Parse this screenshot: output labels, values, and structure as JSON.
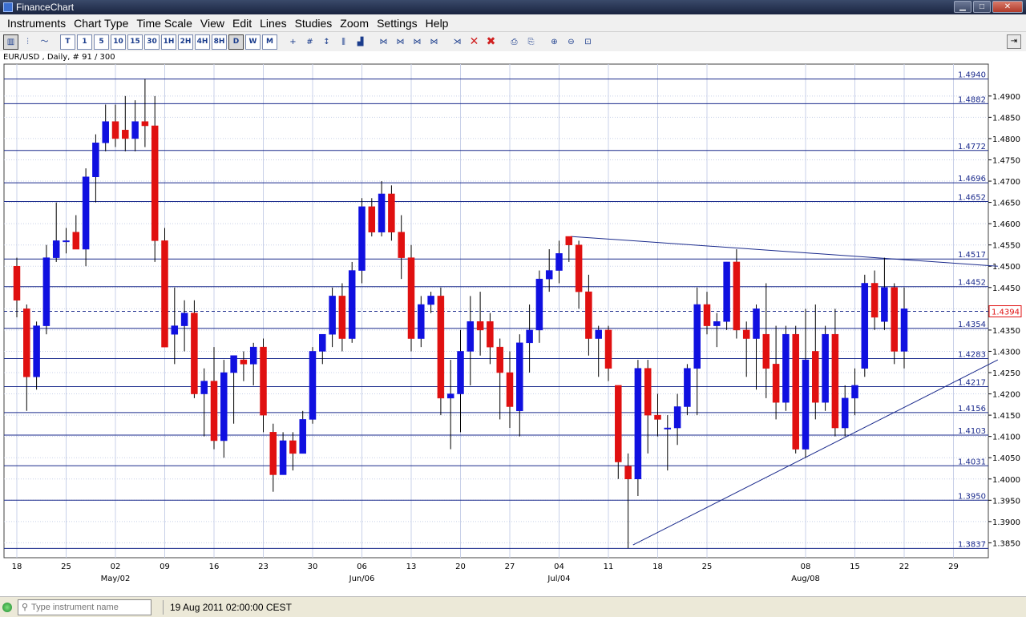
{
  "window": {
    "title": "FinanceChart",
    "min_label": "▁",
    "max_label": "□",
    "close_label": "✕"
  },
  "menu": [
    "Instruments",
    "Chart Type",
    "Time Scale",
    "View",
    "Edit",
    "Lines",
    "Studies",
    "Zoom",
    "Settings",
    "Help"
  ],
  "toolbar": {
    "timeframes": [
      "T",
      "1",
      "5",
      "10",
      "15",
      "30",
      "1H",
      "2H",
      "4H",
      "8H",
      "D",
      "W",
      "M"
    ],
    "active_timeframe": "D"
  },
  "chart_header": "EUR/USD , Daily, # 91 / 300",
  "status": {
    "search_placeholder": "Type instrument name",
    "datetime": "19 Aug 2011 02:00:00 CEST"
  },
  "chart_data": {
    "type": "candlestick",
    "instrument": "EUR/USD",
    "timeframe": "Daily",
    "ylim": [
      1.3815,
      1.4975
    ],
    "y_ticks": [
      1.385,
      1.39,
      1.395,
      1.4,
      1.405,
      1.41,
      1.415,
      1.42,
      1.425,
      1.43,
      1.435,
      1.44,
      1.445,
      1.45,
      1.455,
      1.46,
      1.465,
      1.47,
      1.475,
      1.48,
      1.485,
      1.49
    ],
    "day_ticks": [
      "18",
      "25",
      "02",
      "09",
      "16",
      "23",
      "30",
      "06",
      "13",
      "20",
      "27",
      "04",
      "11",
      "18",
      "25",
      "08",
      "15",
      "22",
      "29"
    ],
    "day_tick_positions": [
      0,
      5,
      10,
      15,
      20,
      25,
      30,
      35,
      40,
      45,
      50,
      55,
      60,
      65,
      70,
      80,
      85,
      90,
      95
    ],
    "month_labels": [
      {
        "label": "May/02",
        "pos": 10
      },
      {
        "label": "Jun/06",
        "pos": 35
      },
      {
        "label": "Jul/04",
        "pos": 55
      },
      {
        "label": "Aug/08",
        "pos": 80
      }
    ],
    "horizontal_lines": [
      1.494,
      1.4882,
      1.4772,
      1.4696,
      1.4652,
      1.4517,
      1.4452,
      1.4354,
      1.4283,
      1.4217,
      1.4156,
      1.4103,
      1.4031,
      1.395,
      1.3837
    ],
    "horizontal_line_labels": [
      "1.4940",
      "1.4882",
      "1.4772",
      "1.4696",
      "1.4652",
      "1.4517",
      "1.4452",
      "1.4354",
      "1.4283",
      "1.4217",
      "1.4156",
      "1.4103",
      "1.4031",
      "1.3950",
      "1.3837"
    ],
    "current_price": 1.4394,
    "current_price_label": "1.4394",
    "trend_lines": [
      {
        "from": {
          "bar": 56.2,
          "price": 1.457
        },
        "to": {
          "bar": 99.5,
          "price": 1.45
        }
      },
      {
        "from": {
          "bar": 62.5,
          "price": 1.3845
        },
        "to": {
          "bar": 99.5,
          "price": 1.428
        }
      }
    ],
    "candles": [
      {
        "i": 0,
        "o": 1.45,
        "h": 1.452,
        "l": 1.438,
        "c": 1.442
      },
      {
        "i": 1,
        "o": 1.44,
        "h": 1.441,
        "l": 1.416,
        "c": 1.424
      },
      {
        "i": 2,
        "o": 1.424,
        "h": 1.437,
        "l": 1.421,
        "c": 1.436
      },
      {
        "i": 3,
        "o": 1.436,
        "h": 1.455,
        "l": 1.434,
        "c": 1.452
      },
      {
        "i": 4,
        "o": 1.452,
        "h": 1.465,
        "l": 1.451,
        "c": 1.456
      },
      {
        "i": 5,
        "o": 1.456,
        "h": 1.459,
        "l": 1.453,
        "c": 1.456
      },
      {
        "i": 6,
        "o": 1.458,
        "h": 1.462,
        "l": 1.454,
        "c": 1.454
      },
      {
        "i": 7,
        "o": 1.454,
        "h": 1.473,
        "l": 1.45,
        "c": 1.471
      },
      {
        "i": 8,
        "o": 1.471,
        "h": 1.481,
        "l": 1.465,
        "c": 1.479
      },
      {
        "i": 9,
        "o": 1.479,
        "h": 1.488,
        "l": 1.477,
        "c": 1.484
      },
      {
        "i": 10,
        "o": 1.484,
        "h": 1.488,
        "l": 1.478,
        "c": 1.48
      },
      {
        "i": 11,
        "o": 1.482,
        "h": 1.49,
        "l": 1.477,
        "c": 1.48
      },
      {
        "i": 12,
        "o": 1.48,
        "h": 1.489,
        "l": 1.477,
        "c": 1.484
      },
      {
        "i": 13,
        "o": 1.484,
        "h": 1.494,
        "l": 1.478,
        "c": 1.483
      },
      {
        "i": 14,
        "o": 1.483,
        "h": 1.49,
        "l": 1.451,
        "c": 1.456
      },
      {
        "i": 15,
        "o": 1.456,
        "h": 1.459,
        "l": 1.431,
        "c": 1.431
      },
      {
        "i": 16,
        "o": 1.434,
        "h": 1.445,
        "l": 1.427,
        "c": 1.436
      },
      {
        "i": 17,
        "o": 1.436,
        "h": 1.442,
        "l": 1.43,
        "c": 1.439
      },
      {
        "i": 18,
        "o": 1.439,
        "h": 1.442,
        "l": 1.419,
        "c": 1.42
      },
      {
        "i": 19,
        "o": 1.42,
        "h": 1.426,
        "l": 1.41,
        "c": 1.423
      },
      {
        "i": 20,
        "o": 1.423,
        "h": 1.431,
        "l": 1.407,
        "c": 1.409
      },
      {
        "i": 21,
        "o": 1.409,
        "h": 1.428,
        "l": 1.405,
        "c": 1.425
      },
      {
        "i": 22,
        "o": 1.425,
        "h": 1.429,
        "l": 1.413,
        "c": 1.429
      },
      {
        "i": 23,
        "o": 1.428,
        "h": 1.43,
        "l": 1.423,
        "c": 1.427
      },
      {
        "i": 24,
        "o": 1.427,
        "h": 1.432,
        "l": 1.422,
        "c": 1.431
      },
      {
        "i": 25,
        "o": 1.431,
        "h": 1.433,
        "l": 1.411,
        "c": 1.415
      },
      {
        "i": 26,
        "o": 1.411,
        "h": 1.413,
        "l": 1.397,
        "c": 1.401
      },
      {
        "i": 27,
        "o": 1.401,
        "h": 1.411,
        "l": 1.401,
        "c": 1.409
      },
      {
        "i": 28,
        "o": 1.409,
        "h": 1.411,
        "l": 1.402,
        "c": 1.406
      },
      {
        "i": 29,
        "o": 1.406,
        "h": 1.416,
        "l": 1.406,
        "c": 1.414
      },
      {
        "i": 30,
        "o": 1.414,
        "h": 1.431,
        "l": 1.413,
        "c": 1.43
      },
      {
        "i": 31,
        "o": 1.43,
        "h": 1.434,
        "l": 1.427,
        "c": 1.434
      },
      {
        "i": 32,
        "o": 1.434,
        "h": 1.445,
        "l": 1.431,
        "c": 1.443
      },
      {
        "i": 33,
        "o": 1.443,
        "h": 1.446,
        "l": 1.43,
        "c": 1.433
      },
      {
        "i": 34,
        "o": 1.433,
        "h": 1.451,
        "l": 1.432,
        "c": 1.449
      },
      {
        "i": 35,
        "o": 1.449,
        "h": 1.466,
        "l": 1.446,
        "c": 1.464
      },
      {
        "i": 36,
        "o": 1.464,
        "h": 1.466,
        "l": 1.457,
        "c": 1.458
      },
      {
        "i": 37,
        "o": 1.458,
        "h": 1.47,
        "l": 1.457,
        "c": 1.467
      },
      {
        "i": 38,
        "o": 1.467,
        "h": 1.469,
        "l": 1.456,
        "c": 1.458
      },
      {
        "i": 39,
        "o": 1.458,
        "h": 1.462,
        "l": 1.447,
        "c": 1.452
      },
      {
        "i": 40,
        "o": 1.452,
        "h": 1.455,
        "l": 1.43,
        "c": 1.433
      },
      {
        "i": 41,
        "o": 1.433,
        "h": 1.443,
        "l": 1.431,
        "c": 1.441
      },
      {
        "i": 42,
        "o": 1.441,
        "h": 1.444,
        "l": 1.439,
        "c": 1.443
      },
      {
        "i": 43,
        "o": 1.443,
        "h": 1.445,
        "l": 1.415,
        "c": 1.419
      },
      {
        "i": 44,
        "o": 1.419,
        "h": 1.428,
        "l": 1.407,
        "c": 1.42
      },
      {
        "i": 45,
        "o": 1.42,
        "h": 1.435,
        "l": 1.411,
        "c": 1.43
      },
      {
        "i": 46,
        "o": 1.43,
        "h": 1.443,
        "l": 1.422,
        "c": 1.437
      },
      {
        "i": 47,
        "o": 1.437,
        "h": 1.444,
        "l": 1.429,
        "c": 1.435
      },
      {
        "i": 48,
        "o": 1.437,
        "h": 1.439,
        "l": 1.427,
        "c": 1.431
      },
      {
        "i": 49,
        "o": 1.431,
        "h": 1.433,
        "l": 1.414,
        "c": 1.425
      },
      {
        "i": 50,
        "o": 1.425,
        "h": 1.43,
        "l": 1.412,
        "c": 1.417
      },
      {
        "i": 51,
        "o": 1.416,
        "h": 1.434,
        "l": 1.41,
        "c": 1.432
      },
      {
        "i": 52,
        "o": 1.432,
        "h": 1.441,
        "l": 1.425,
        "c": 1.435
      },
      {
        "i": 53,
        "o": 1.435,
        "h": 1.449,
        "l": 1.432,
        "c": 1.447
      },
      {
        "i": 54,
        "o": 1.447,
        "h": 1.454,
        "l": 1.444,
        "c": 1.449
      },
      {
        "i": 55,
        "o": 1.449,
        "h": 1.456,
        "l": 1.446,
        "c": 1.453
      },
      {
        "i": 56,
        "o": 1.457,
        "h": 1.457,
        "l": 1.451,
        "c": 1.455
      },
      {
        "i": 57,
        "o": 1.455,
        "h": 1.456,
        "l": 1.44,
        "c": 1.444
      },
      {
        "i": 58,
        "o": 1.444,
        "h": 1.448,
        "l": 1.429,
        "c": 1.433
      },
      {
        "i": 59,
        "o": 1.433,
        "h": 1.436,
        "l": 1.424,
        "c": 1.435
      },
      {
        "i": 60,
        "o": 1.435,
        "h": 1.436,
        "l": 1.423,
        "c": 1.426
      },
      {
        "i": 61,
        "o": 1.422,
        "h": 1.422,
        "l": 1.4,
        "c": 1.404
      },
      {
        "i": 62,
        "o": 1.403,
        "h": 1.406,
        "l": 1.3837,
        "c": 1.4
      },
      {
        "i": 63,
        "o": 1.4,
        "h": 1.428,
        "l": 1.396,
        "c": 1.426
      },
      {
        "i": 64,
        "o": 1.426,
        "h": 1.428,
        "l": 1.406,
        "c": 1.415
      },
      {
        "i": 65,
        "o": 1.415,
        "h": 1.42,
        "l": 1.41,
        "c": 1.414
      },
      {
        "i": 66,
        "o": 1.412,
        "h": 1.415,
        "l": 1.402,
        "c": 1.412
      },
      {
        "i": 67,
        "o": 1.412,
        "h": 1.42,
        "l": 1.408,
        "c": 1.417
      },
      {
        "i": 68,
        "o": 1.417,
        "h": 1.427,
        "l": 1.415,
        "c": 1.426
      },
      {
        "i": 69,
        "o": 1.426,
        "h": 1.445,
        "l": 1.415,
        "c": 1.441
      },
      {
        "i": 70,
        "o": 1.441,
        "h": 1.444,
        "l": 1.434,
        "c": 1.436
      },
      {
        "i": 71,
        "o": 1.436,
        "h": 1.439,
        "l": 1.431,
        "c": 1.437
      },
      {
        "i": 72,
        "o": 1.437,
        "h": 1.451,
        "l": 1.435,
        "c": 1.451
      },
      {
        "i": 73,
        "o": 1.451,
        "h": 1.454,
        "l": 1.433,
        "c": 1.435
      },
      {
        "i": 74,
        "o": 1.435,
        "h": 1.437,
        "l": 1.424,
        "c": 1.433
      },
      {
        "i": 75,
        "o": 1.433,
        "h": 1.441,
        "l": 1.421,
        "c": 1.44
      },
      {
        "i": 76,
        "o": 1.434,
        "h": 1.446,
        "l": 1.419,
        "c": 1.426
      },
      {
        "i": 77,
        "o": 1.427,
        "h": 1.436,
        "l": 1.414,
        "c": 1.418
      },
      {
        "i": 78,
        "o": 1.418,
        "h": 1.436,
        "l": 1.416,
        "c": 1.434
      },
      {
        "i": 79,
        "o": 1.434,
        "h": 1.436,
        "l": 1.406,
        "c": 1.407
      },
      {
        "i": 80,
        "o": 1.407,
        "h": 1.44,
        "l": 1.405,
        "c": 1.428
      },
      {
        "i": 81,
        "o": 1.43,
        "h": 1.441,
        "l": 1.414,
        "c": 1.418
      },
      {
        "i": 82,
        "o": 1.418,
        "h": 1.436,
        "l": 1.416,
        "c": 1.434
      },
      {
        "i": 83,
        "o": 1.434,
        "h": 1.44,
        "l": 1.41,
        "c": 1.412
      },
      {
        "i": 84,
        "o": 1.412,
        "h": 1.422,
        "l": 1.41,
        "c": 1.419
      },
      {
        "i": 85,
        "o": 1.419,
        "h": 1.426,
        "l": 1.415,
        "c": 1.422
      },
      {
        "i": 86,
        "o": 1.426,
        "h": 1.448,
        "l": 1.424,
        "c": 1.446
      },
      {
        "i": 87,
        "o": 1.446,
        "h": 1.449,
        "l": 1.435,
        "c": 1.438
      },
      {
        "i": 88,
        "o": 1.437,
        "h": 1.452,
        "l": 1.435,
        "c": 1.445
      },
      {
        "i": 89,
        "o": 1.445,
        "h": 1.446,
        "l": 1.427,
        "c": 1.43
      },
      {
        "i": 90,
        "o": 1.43,
        "h": 1.445,
        "l": 1.426,
        "c": 1.44
      }
    ]
  },
  "colors": {
    "up": "#1010e0",
    "down": "#e01010",
    "hline": "#1a2a8c",
    "grid": "#c8d0e8",
    "axis_text": "#000000",
    "hline_label": "#1a2a8c",
    "current_price": "#e01010"
  }
}
